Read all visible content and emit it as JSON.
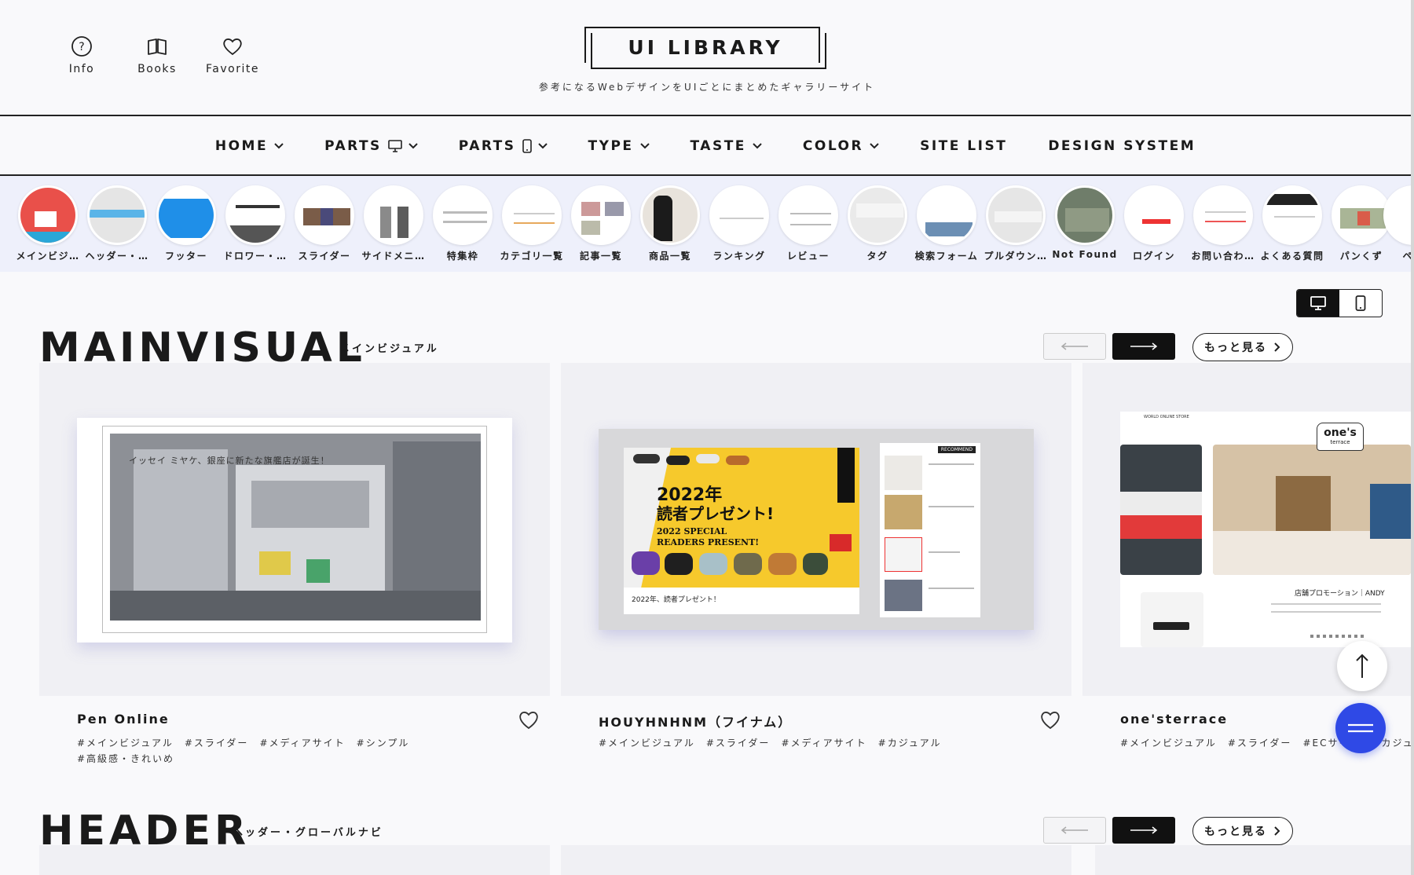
{
  "header": {
    "icons": [
      {
        "label": "Info",
        "icon": "info-icon"
      },
      {
        "label": "Books",
        "icon": "book-icon"
      },
      {
        "label": "Favorite",
        "icon": "heart-icon"
      }
    ],
    "logo": "UI LIBRARY",
    "tagline": "参考になるWebデザインをUIごとにまとめたギャラリーサイト"
  },
  "nav": [
    {
      "label": "HOME",
      "icon": "chevron-down-icon"
    },
    {
      "label": "PARTS",
      "icon": "monitor-icon"
    },
    {
      "label": "PARTS",
      "icon": "smartphone-icon"
    },
    {
      "label": "TYPE",
      "icon": "chevron-down-icon"
    },
    {
      "label": "TASTE",
      "icon": "chevron-down-icon"
    },
    {
      "label": "COLOR",
      "icon": "chevron-down-icon"
    },
    {
      "label": "SITE LIST"
    },
    {
      "label": "DESIGN SYSTEM"
    }
  ],
  "categories": [
    "メインビジ…",
    "ヘッダー・…",
    "フッター",
    "ドロワー・…",
    "スライダー",
    "サイドメニ…",
    "特集枠",
    "カテゴリ一覧",
    "記事一覧",
    "商品一覧",
    "ランキング",
    "レビュー",
    "タグ",
    "検索フォーム",
    "プルダウン…",
    "Not Found",
    "ログイン",
    "お問い合わ…",
    "よくある質問",
    "パンくず",
    "ペー"
  ],
  "mainvisual": {
    "title": "MAINVISUAL",
    "subtitle": "メインビジュアル",
    "more": "もっと見る",
    "cards": [
      {
        "title": "Pen Online",
        "tags": [
          "#メインビジュアル",
          "#スライダー",
          "#メディアサイト",
          "#シンプル",
          "#高級感・きれいめ"
        ],
        "overlay": "イッセイ ミヤケ、銀座に新たな旗艦店が誕生！"
      },
      {
        "title": "HOUYHNHNM（フイナム）",
        "tags": [
          "#メインビジュアル",
          "#スライダー",
          "#メディアサイト",
          "#カジュアル"
        ],
        "headline1": "2022年",
        "headline2": "読者プレゼント!",
        "en1": "2022 SPECIAL",
        "en2": "READERS PRESENT!",
        "caption": "2022年、読者プレゼント！",
        "badge": "RECOMMEND"
      },
      {
        "title": "one'sterrace",
        "tags": [
          "#メインビジュアル",
          "#スライダー",
          "#ECサイト",
          "#カジュアル"
        ],
        "brand1": "one's",
        "brand2": "terrace",
        "store": "WORLD ONLINE STORE",
        "promo": "店舗プロモーション｜ANDY"
      }
    ]
  },
  "header_section": {
    "title": "HEADER",
    "subtitle": "ヘッダー・グローバルナビ",
    "more": "もっと見る"
  },
  "colors": {
    "accent": "#2f49e6",
    "dark": "#111111",
    "strip": "#eef0fb"
  }
}
